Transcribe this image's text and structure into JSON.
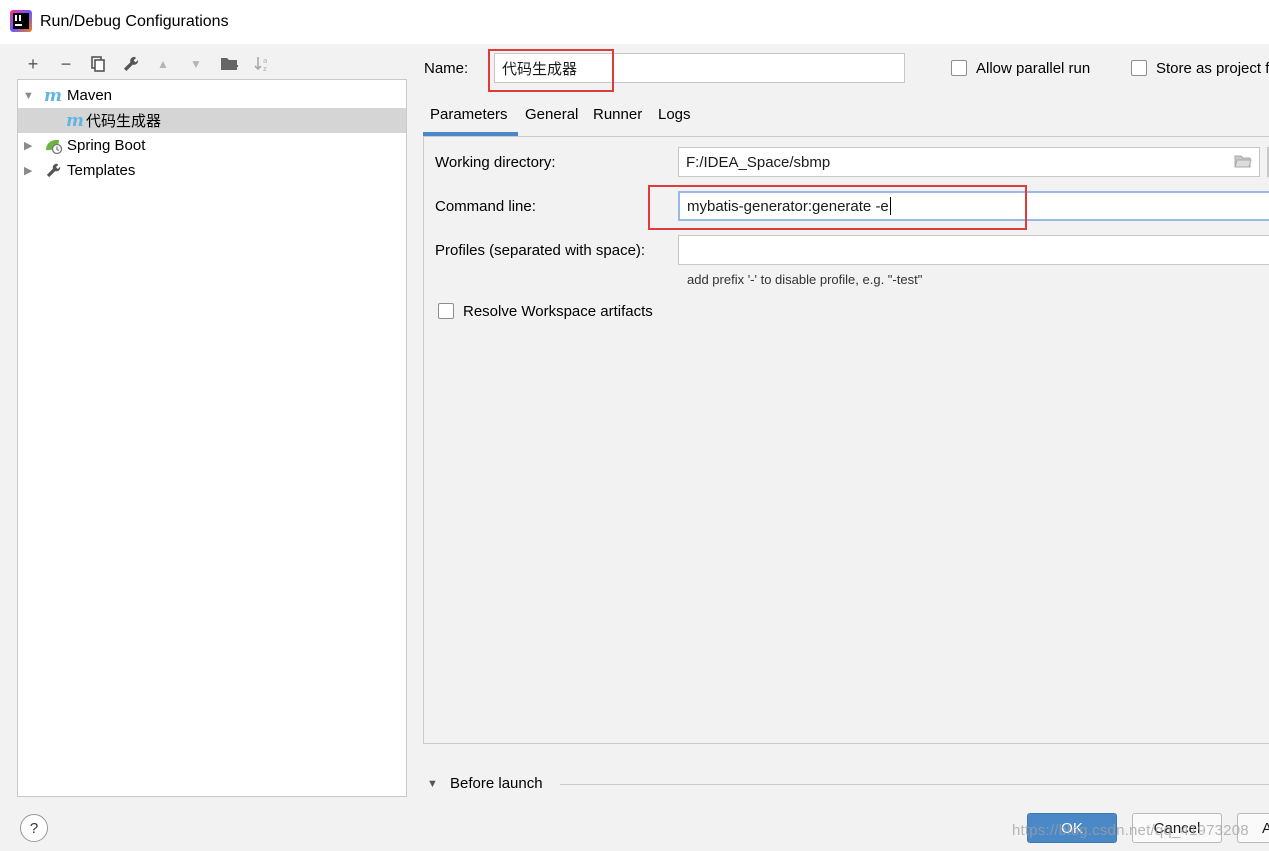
{
  "window": {
    "title": "Run/Debug Configurations",
    "app_icon": "intellij-idea-icon"
  },
  "toolbar": {
    "icons": [
      "add-icon",
      "remove-icon",
      "copy-icon",
      "wrench-icon",
      "move-up-icon",
      "move-down-icon",
      "folder-add-icon",
      "sort-az-icon"
    ],
    "add": "+",
    "remove": "−",
    "copy": "⧉",
    "wrench": "🔧",
    "up": "▲",
    "down": "▼",
    "folder": "📁",
    "sort": "↓ᶻ"
  },
  "tree": {
    "maven": {
      "label": "Maven",
      "icon": "m"
    },
    "maven_child": {
      "label": "代码生成器",
      "icon": "m"
    },
    "spring_boot": {
      "label": "Spring Boot"
    },
    "templates": {
      "label": "Templates"
    }
  },
  "form": {
    "name_label": "Name:",
    "name_value": "代码生成器",
    "allow_parallel_label": "Allow parallel run",
    "store_project_label": "Store as project file"
  },
  "tabs": [
    "Parameters",
    "General",
    "Runner",
    "Logs"
  ],
  "params": {
    "working_dir_label": "Working directory:",
    "working_dir_value": "F:/IDEA_Space/sbmp",
    "command_line_label": "Command line:",
    "command_line_value": "mybatis-generator:generate -e",
    "profiles_label": "Profiles (separated with space):",
    "profiles_value": "",
    "profiles_hint": "add prefix '-' to disable profile, e.g. \"-test\"",
    "resolve_label": "Resolve Workspace artifacts"
  },
  "before_launch": {
    "label": "Before launch"
  },
  "buttons": {
    "help": "?",
    "ok": "OK",
    "cancel": "Cancel",
    "apply": "Apply"
  },
  "watermark": "https://blog.csdn.net/qq_41973208",
  "colors": {
    "accent": "#4a88c7",
    "highlight_box": "#e03b3b",
    "ok_button": "#4a88c7"
  }
}
